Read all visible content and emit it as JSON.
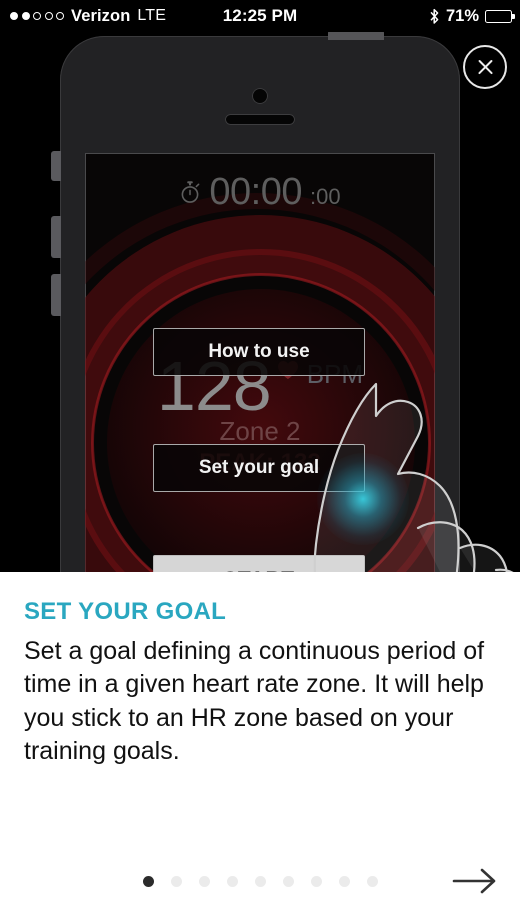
{
  "statusbar": {
    "signal_filled": 2,
    "signal_total": 5,
    "carrier": "Verizon",
    "network": "LTE",
    "time": "12:25 PM",
    "bluetooth_icon": "bluetooth-icon",
    "battery_percent": "71%",
    "battery_level": 71
  },
  "overlay": {
    "close_icon": "close-icon"
  },
  "phone_screen": {
    "timer": {
      "icon": "stopwatch-icon",
      "main": "00:00",
      "centiseconds": "00"
    },
    "heart_rate": {
      "value": "128",
      "heart_icon": "heart-icon",
      "unit": "BPM",
      "zone": "Zone 2",
      "peak": "PEAK: 132"
    },
    "buttons": {
      "how_to_use": "How to use",
      "set_your_goal": "Set your goal",
      "start": "START"
    },
    "touch_indicator": {
      "name": "finger-tap-indicator",
      "glow_color": "#28cde1"
    }
  },
  "tutorial": {
    "title": "SET YOUR GOAL",
    "title_color": "#2aa7c0",
    "body": "Set a goal defining a continuous period of time in a given heart rate zone. It will help you stick to an HR zone based on your training goals.",
    "pager": {
      "total": 9,
      "active_index": 0,
      "active_color": "#2b2b2b",
      "inactive_color": "#ebebeb"
    },
    "next_icon": "arrow-right-icon"
  }
}
